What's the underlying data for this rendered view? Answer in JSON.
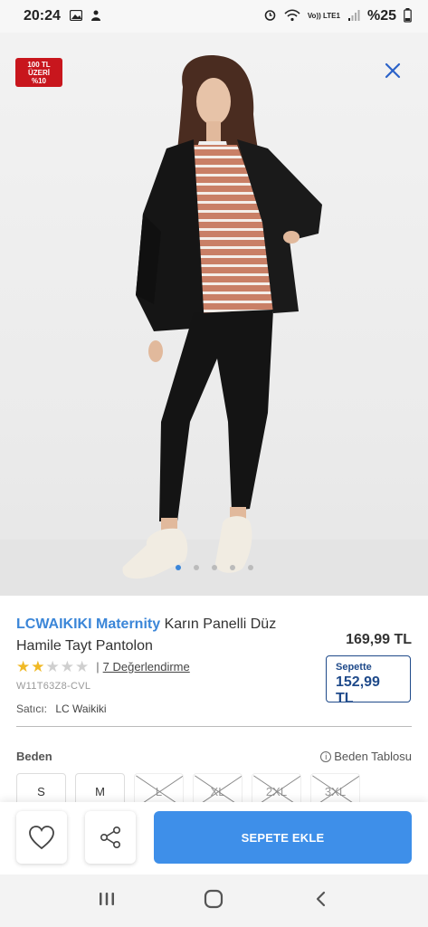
{
  "status": {
    "time": "20:24",
    "network": "Vo)) LTE1",
    "battery": "%25"
  },
  "badge": {
    "line1": "100 TL",
    "line2": "ÜZERİ",
    "line3": "%10"
  },
  "product": {
    "brand": "LCWAIKIKI Maternity",
    "name": "Karın Panelli Düz Hamile Tayt Pantolon",
    "price": "169,99 TL",
    "cart_label": "Sepette",
    "cart_price": "152,99 TL",
    "rating": 2,
    "rating_max": 5,
    "reviews": "7 Değerlendirme",
    "sku": "W11T63Z8-CVL",
    "seller_label": "Satıcı:",
    "seller": "LC Waikiki"
  },
  "sizes": {
    "heading": "Beden",
    "guide": "Beden Tablosu",
    "items": [
      {
        "label": "S",
        "available": true
      },
      {
        "label": "M",
        "available": true
      },
      {
        "label": "L",
        "available": false
      },
      {
        "label": "XL",
        "available": false
      },
      {
        "label": "2XL",
        "available": false
      },
      {
        "label": "3XL",
        "available": false
      }
    ]
  },
  "actions": {
    "add_to_cart": "SEPETE EKLE"
  },
  "colors": {
    "brand_blue": "#3b86d8",
    "button_blue": "#3e8fe9",
    "badge_red": "#c8161d",
    "cart_navy": "#1f4a8a",
    "star": "#f0b925"
  },
  "carousel": {
    "count": 5,
    "active": 1
  }
}
